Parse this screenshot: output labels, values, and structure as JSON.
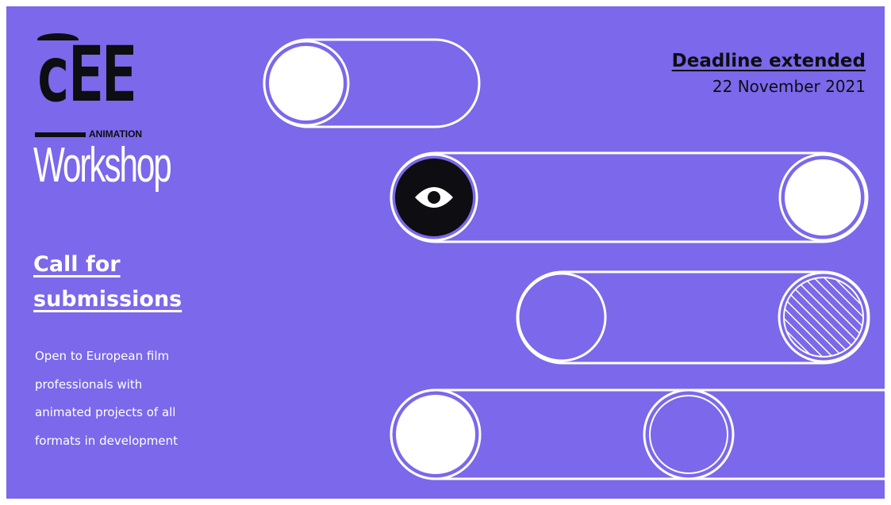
{
  "brand": {
    "logo_main": "cEE",
    "logo_sub": "ANIMATION",
    "logo_product": "Workshop"
  },
  "headline": {
    "line1": "Call for",
    "line2": "submissions"
  },
  "description": {
    "line1": "Open to European film",
    "line2": "professionals with",
    "line3": "animated projects of all",
    "line4": "formats in development"
  },
  "deadline": {
    "title": "Deadline extended",
    "date": "22 November 2021"
  },
  "colors": {
    "background": "#7b68ea",
    "ink": "#0d0d12",
    "white": "#ffffff"
  },
  "icons": [
    "eye-icon"
  ]
}
